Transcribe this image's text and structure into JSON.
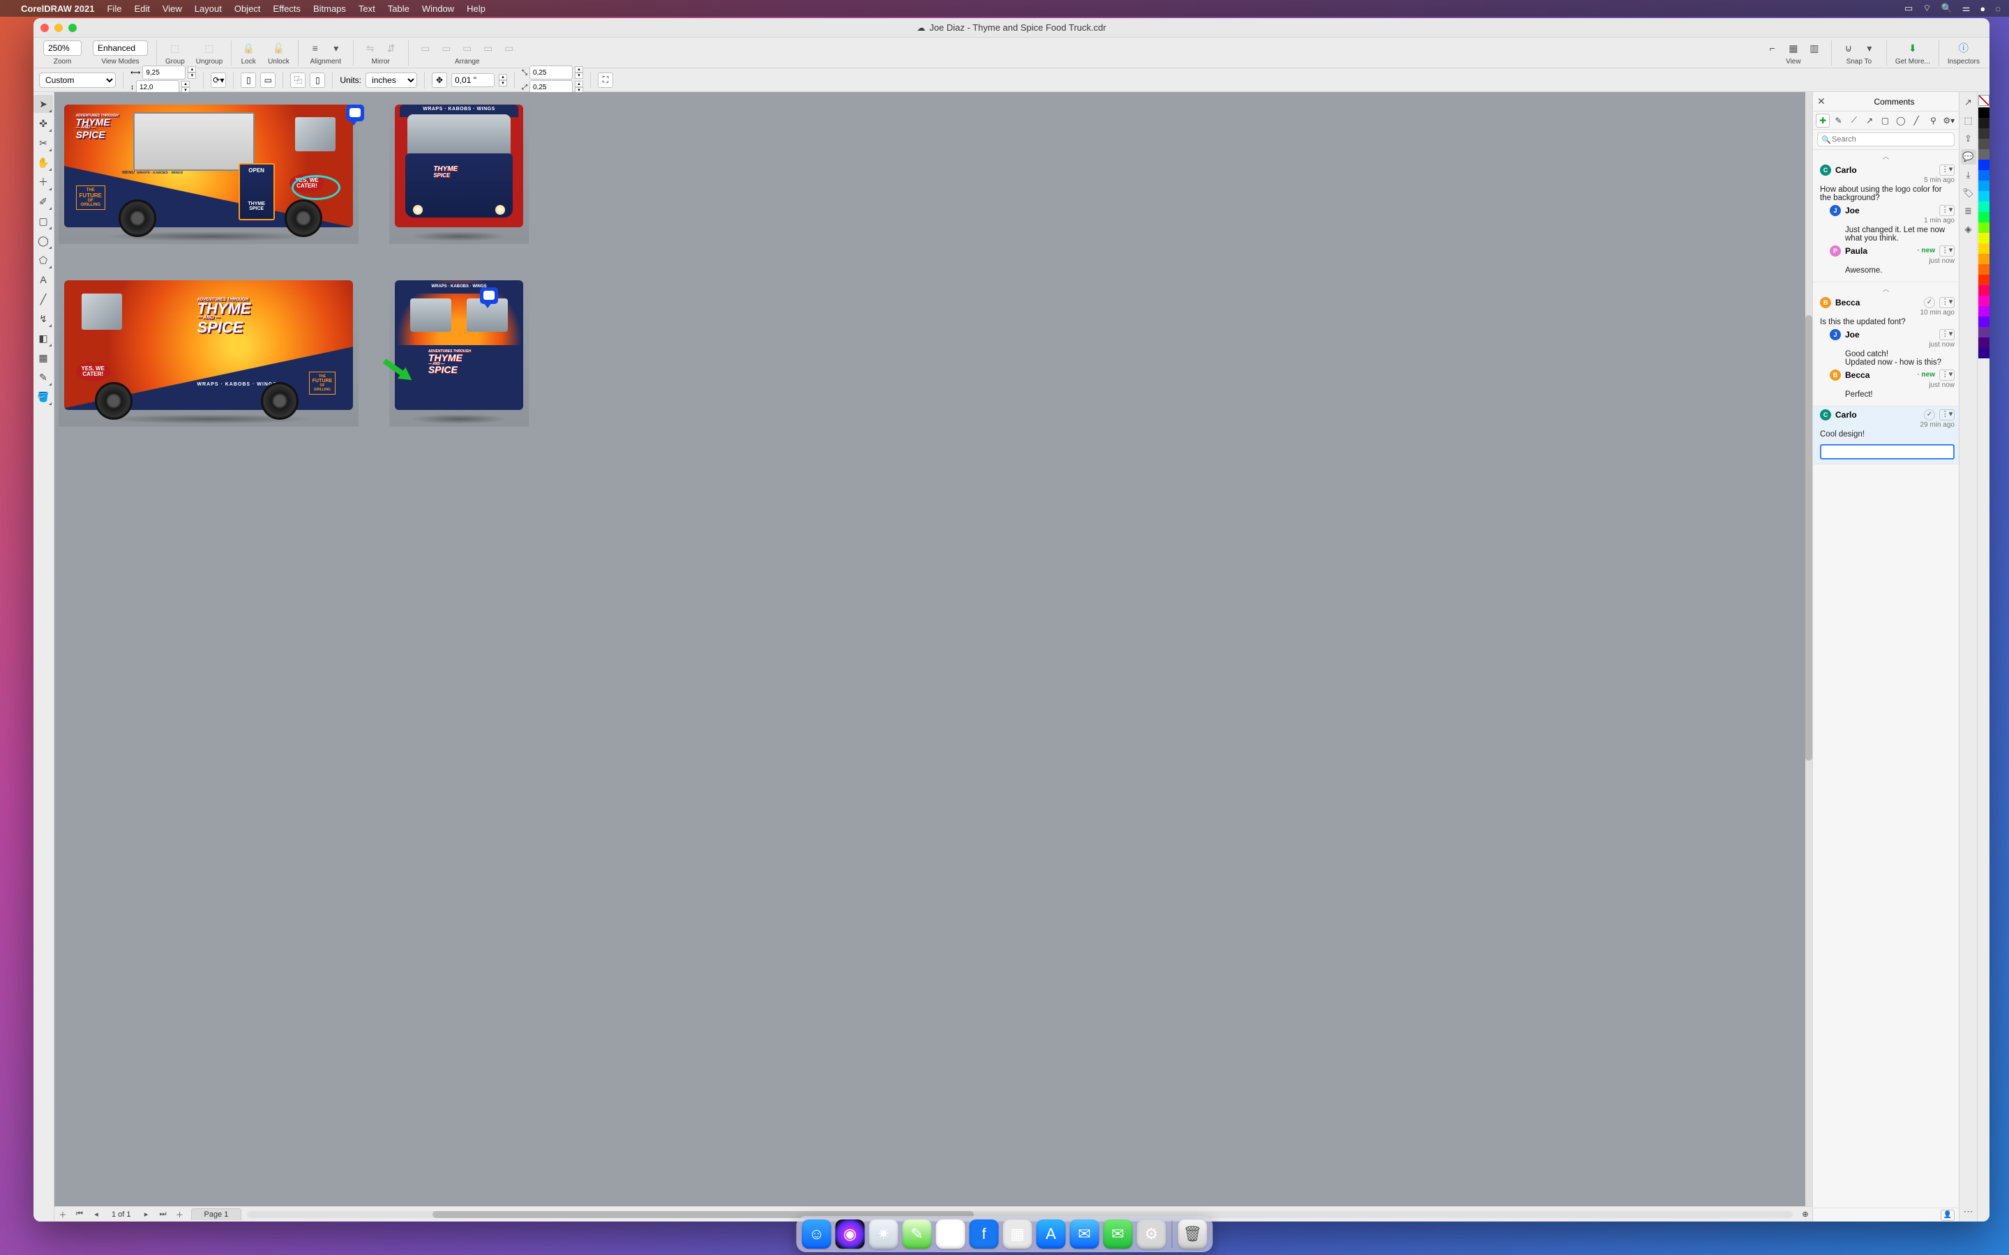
{
  "menubar": {
    "app": "CorelDRAW 2021",
    "items": [
      "File",
      "Edit",
      "View",
      "Layout",
      "Object",
      "Effects",
      "Bitmaps",
      "Text",
      "Table",
      "Window",
      "Help"
    ]
  },
  "window": {
    "title": "Joe Diaz - Thyme and Spice Food Truck.cdr"
  },
  "toolbar": {
    "zoom_value": "250% ",
    "zoom_label": "Zoom",
    "view_mode": "Enhanced ",
    "view_label": "View Modes",
    "group": "Group",
    "ungroup": "Ungroup",
    "lock": "Lock",
    "unlock": "Unlock",
    "alignment": "Alignment",
    "mirror": "Mirror",
    "arrange": "Arrange",
    "view": "View",
    "snap": "Snap To",
    "getmore": "Get More...",
    "inspectors": "Inspectors"
  },
  "propbar": {
    "page_preset": "Custom",
    "x": "9,25",
    "y": "12,0",
    "units_label": "Units:",
    "units_value": "inches",
    "nudge": "0,01 \"",
    "dup_x": "0,25",
    "dup_y": "0,25"
  },
  "canvas": {
    "tagline": "WRAPS · KABOBS · WINGS",
    "brand_top": "ADVENTURES THROUGH",
    "brand_main1": "THYME",
    "brand_and": "AND",
    "brand_main2": "SPICE",
    "menu_label": "MENU",
    "future": "THE",
    "future2": "FUTURE",
    "future3": "OF",
    "future4": "GRILLING",
    "open": "OPEN",
    "cater1": "YES, WE",
    "cater2": "CATER!"
  },
  "comments_panel": {
    "title": "Comments",
    "search_placeholder": "Search",
    "threads": [
      {
        "author": "Carlo",
        "avatar": "C",
        "cls": "av-c",
        "time": "5 min ago",
        "text": "How about using the logo color for the background?",
        "replies": [
          {
            "author": "Joe",
            "avatar": "J",
            "cls": "av-j",
            "time": "1 min ago",
            "text": "Just changed it. Let me now what you think."
          },
          {
            "author": "Paula",
            "avatar": "P",
            "cls": "av-p",
            "time": "just now",
            "is_new": true,
            "text": "Awesome."
          }
        ]
      },
      {
        "author": "Becca",
        "avatar": "B",
        "cls": "av-b",
        "time": "10 min ago",
        "resolved": true,
        "text": "Is this the updated font?",
        "replies": [
          {
            "author": "Joe",
            "avatar": "J",
            "cls": "av-j",
            "time": "just now",
            "text": "Good catch!\nUpdated now - how is this?"
          },
          {
            "author": "Becca",
            "avatar": "B",
            "cls": "av-b",
            "time": "just now",
            "is_new": true,
            "text": "Perfect!"
          }
        ]
      },
      {
        "author": "Carlo",
        "avatar": "C",
        "cls": "av-c",
        "time": "29 min ago",
        "resolved": true,
        "highlight": true,
        "text": "Cool design!",
        "reply_input": true
      }
    ]
  },
  "pagebar": {
    "info": "1 of 1",
    "tab": "Page 1"
  },
  "palette": [
    "#000000",
    "#1a1a1a",
    "#333333",
    "#4d4d4d",
    "#666666",
    "#0034ff",
    "#006eff",
    "#00a2ff",
    "#00d2ff",
    "#00ffb5",
    "#00ff44",
    "#7bff00",
    "#e9ff00",
    "#ffd800",
    "#ffa200",
    "#ff6a00",
    "#ff2d00",
    "#ff0062",
    "#ff00c3",
    "#c300ff",
    "#6a00ff",
    "#663399",
    "#4b0082",
    "#2e008b"
  ],
  "dock": {
    "apps": [
      {
        "name": "finder",
        "bg": "linear-gradient(180deg,#36a7ff,#0a66ff)",
        "glyph": "☺"
      },
      {
        "name": "siri",
        "bg": "radial-gradient(circle,#ff3bd4,#5a2bff 60%,#111 80%)",
        "glyph": "◉"
      },
      {
        "name": "safari",
        "bg": "linear-gradient(180deg,#eef3f8,#cdd7e1)",
        "glyph": "✷"
      },
      {
        "name": "notes",
        "bg": "linear-gradient(180deg,#e8ffd0,#4fd13a)",
        "glyph": "✎"
      },
      {
        "name": "photos",
        "bg": "#fff",
        "glyph": "✿"
      },
      {
        "name": "facebook",
        "bg": "#1877f2",
        "glyph": "f"
      },
      {
        "name": "launchpad",
        "bg": "#e8e8e8",
        "glyph": "▦"
      },
      {
        "name": "appstore",
        "bg": "linear-gradient(180deg,#2fb6ff,#0a66ff)",
        "glyph": "A"
      },
      {
        "name": "mail",
        "bg": "linear-gradient(180deg,#4fc3ff,#0a66ff)",
        "glyph": "✉"
      },
      {
        "name": "messages",
        "bg": "linear-gradient(180deg,#6fe96f,#1ebf3a)",
        "glyph": "✉"
      },
      {
        "name": "settings",
        "bg": "#d8d8d8",
        "glyph": "⚙"
      }
    ]
  }
}
